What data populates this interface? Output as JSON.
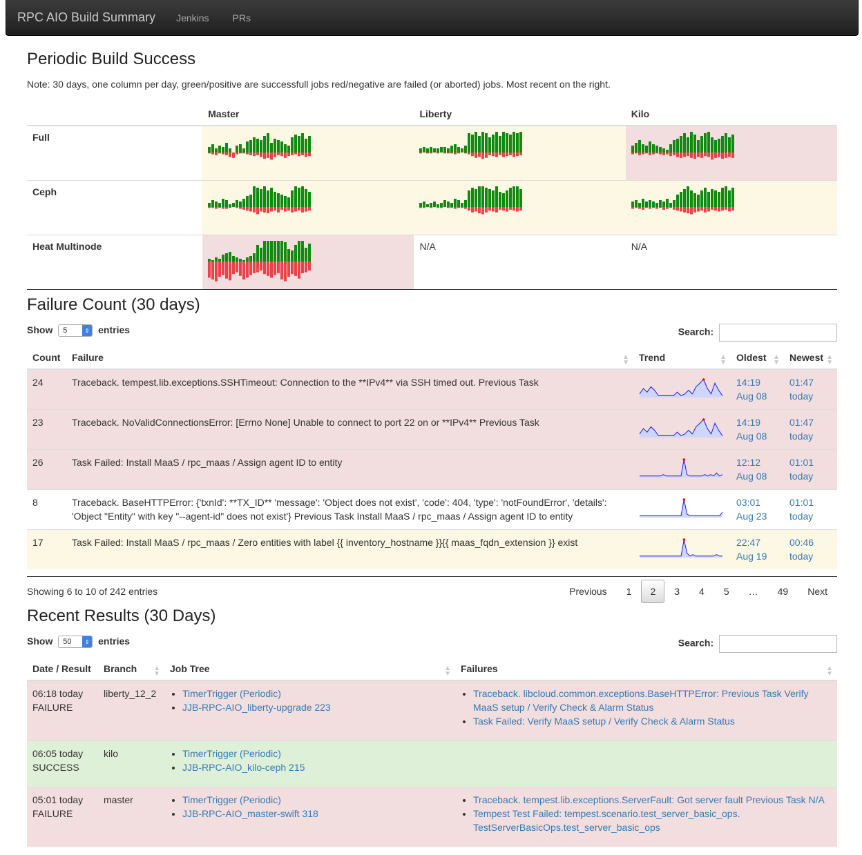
{
  "nav": {
    "brand": "RPC AIO Build Summary",
    "links": [
      "Jenkins",
      "PRs"
    ]
  },
  "periodic": {
    "title": "Periodic Build Success",
    "note": "Note: 30 days, one column per day, green/positive are successfull jobs red/negative are failed (or aborted) jobs. Most recent on the right.",
    "columns": [
      "Master",
      "Liberty",
      "Kilo"
    ],
    "rows": [
      {
        "label": "Full",
        "cells": [
          {
            "status": "warning",
            "ok": [
              4,
              6,
              3,
              5,
              4,
              7,
              3,
              0,
              5,
              6,
              3,
              8,
              9,
              11,
              10,
              9,
              12,
              14,
              7,
              10,
              9,
              8,
              6,
              5,
              11,
              13,
              12,
              14,
              10,
              12
            ],
            "fail": [
              1,
              2,
              3,
              1,
              2,
              3,
              5,
              6,
              2,
              1,
              1,
              2,
              3,
              4,
              3,
              5,
              7,
              6,
              8,
              5,
              3,
              4,
              6,
              4,
              3,
              2,
              4,
              3,
              5,
              4
            ]
          },
          {
            "status": "warning",
            "ok": [
              3,
              4,
              3,
              4,
              3,
              3,
              4,
              4,
              3,
              5,
              6,
              4,
              3,
              5,
              14,
              13,
              15,
              12,
              16,
              14,
              11,
              13,
              15,
              12,
              16,
              14,
              13,
              15,
              14,
              16
            ],
            "fail": [
              1,
              0,
              1,
              1,
              0,
              1,
              0,
              1,
              1,
              1,
              2,
              1,
              0,
              1,
              2,
              4,
              6,
              5,
              7,
              6,
              3,
              4,
              5,
              3,
              5,
              4,
              3,
              5,
              4,
              3
            ]
          },
          {
            "status": "danger",
            "ok": [
              5,
              7,
              9,
              6,
              5,
              8,
              6,
              5,
              4,
              3,
              2,
              6,
              9,
              10,
              12,
              14,
              11,
              15,
              13,
              9,
              12,
              14,
              16,
              11,
              9,
              10,
              12,
              14,
              11,
              13
            ],
            "fail": [
              2,
              1,
              3,
              2,
              1,
              3,
              2,
              1,
              2,
              3,
              2,
              4,
              3,
              5,
              6,
              5,
              4,
              6,
              7,
              5,
              6,
              4,
              5,
              8,
              6,
              5,
              7,
              6,
              5,
              6
            ]
          }
        ]
      },
      {
        "label": "Ceph",
        "cells": [
          {
            "status": "warning",
            "ok": [
              3,
              5,
              4,
              3,
              6,
              5,
              2,
              3,
              5,
              4,
              6,
              8,
              9,
              15,
              14,
              13,
              15,
              12,
              14,
              11,
              10,
              9,
              8,
              7,
              12,
              16,
              14,
              15,
              13,
              11
            ],
            "fail": [
              1,
              1,
              2,
              1,
              2,
              2,
              1,
              0,
              1,
              2,
              3,
              4,
              5,
              6,
              8,
              5,
              6,
              7,
              5,
              4,
              6,
              3,
              5,
              4,
              6,
              5,
              4,
              6,
              5,
              4
            ]
          },
          {
            "status": "warning",
            "ok": [
              3,
              4,
              2,
              3,
              4,
              2,
              3,
              5,
              4,
              3,
              6,
              5,
              3,
              5,
              12,
              14,
              13,
              15,
              16,
              14,
              13,
              12,
              15,
              11,
              10,
              12,
              14,
              16,
              15,
              13
            ],
            "fail": [
              1,
              1,
              0,
              1,
              0,
              1,
              1,
              0,
              1,
              1,
              2,
              1,
              1,
              2,
              4,
              6,
              5,
              7,
              8,
              6,
              4,
              5,
              6,
              3,
              4,
              5,
              3,
              4,
              5,
              4
            ]
          },
          {
            "status": "warning",
            "ok": [
              4,
              5,
              3,
              6,
              4,
              5,
              4,
              3,
              5,
              4,
              6,
              3,
              5,
              9,
              11,
              13,
              15,
              12,
              10,
              9,
              12,
              14,
              11,
              13,
              12,
              11,
              14,
              16,
              12,
              14
            ],
            "fail": [
              2,
              1,
              2,
              3,
              1,
              2,
              1,
              2,
              1,
              3,
              2,
              1,
              3,
              4,
              5,
              6,
              7,
              8,
              6,
              5,
              4,
              6,
              5,
              3,
              4,
              5,
              4,
              3,
              5,
              4
            ]
          }
        ]
      },
      {
        "label": "Heat Multinode",
        "cells": [
          {
            "status": "danger",
            "ok": [
              2,
              1,
              3,
              2,
              5,
              6,
              7,
              4,
              3,
              2,
              1,
              3,
              4,
              6,
              12,
              10,
              18,
              22,
              15,
              20,
              25,
              16,
              14,
              9,
              8,
              12,
              18,
              15,
              10,
              13
            ],
            "fail": [
              18,
              20,
              22,
              17,
              15,
              19,
              21,
              14,
              12,
              16,
              20,
              18,
              15,
              13,
              12,
              10,
              14,
              16,
              18,
              15,
              13,
              20,
              22,
              17,
              14,
              16,
              19,
              13,
              12,
              10
            ]
          },
          {
            "status": "none",
            "text": "N/A"
          },
          {
            "status": "none",
            "text": "N/A"
          }
        ]
      }
    ]
  },
  "failure_count": {
    "title": "Failure Count (30 days)",
    "show_label": "Show",
    "entries_label": "entries",
    "page_length": "5",
    "search_label": "Search:",
    "columns": [
      "Count",
      "Failure",
      "Trend",
      "Oldest",
      "Newest"
    ],
    "rows": [
      {
        "status": "danger",
        "count": "24",
        "failure": "Traceback. tempest.lib.exceptions.SSHTimeout: Connection to the **IPv4** via SSH timed out. Previous Task",
        "trend": [
          2,
          5,
          3,
          6,
          4,
          1,
          1,
          1,
          1,
          1,
          3,
          1,
          2,
          4,
          2,
          6,
          8,
          10,
          5,
          2,
          8,
          4,
          1
        ],
        "oldest_time": "14:19",
        "oldest_date": "Aug 08",
        "newest_time": "01:47",
        "newest_date": "today"
      },
      {
        "status": "danger",
        "count": "23",
        "failure": "Traceback. NoValidConnectionsError: [Errno None] Unable to connect to port 22 on or **IPv4** Previous Task",
        "trend": [
          2,
          5,
          3,
          6,
          4,
          1,
          1,
          1,
          1,
          1,
          3,
          1,
          2,
          4,
          2,
          6,
          8,
          10,
          5,
          2,
          8,
          4,
          1
        ],
        "oldest_time": "14:19",
        "oldest_date": "Aug 08",
        "newest_time": "01:47",
        "newest_date": "today"
      },
      {
        "status": "danger",
        "count": "26",
        "failure": "Task Failed: Install MaaS / rpc_maas / Assign agent ID to entity",
        "trend": [
          1,
          1,
          1,
          1,
          1,
          1,
          1,
          1,
          2,
          1,
          1,
          1,
          1,
          1,
          1,
          12,
          2,
          1,
          1,
          1,
          1,
          1,
          2,
          1,
          2,
          1,
          3,
          1,
          2
        ],
        "oldest_time": "12:12",
        "oldest_date": "Aug 08",
        "newest_time": "01:01",
        "newest_date": "today"
      },
      {
        "status": "none",
        "count": "8",
        "failure": "Traceback. BaseHTTPError: {'txnId': **TX_ID** 'message': 'Object does not exist', 'code': 404, 'type': 'notFoundError', 'details': 'Object \"Entity\" with key \"--agent-id\" does not exist'} Previous Task Install MaaS / rpc_maas / Assign agent ID to entity",
        "trend": [
          1,
          1,
          1,
          1,
          1,
          1,
          1,
          1,
          1,
          1,
          1,
          1,
          1,
          1,
          1,
          10,
          2,
          1,
          1,
          1,
          1,
          1,
          1,
          1,
          1,
          1,
          1,
          1,
          3
        ],
        "oldest_time": "03:01",
        "oldest_date": "Aug 23",
        "newest_time": "01:01",
        "newest_date": "today"
      },
      {
        "status": "warning",
        "count": "17",
        "failure": "Task Failed: Install MaaS / rpc_maas / Zero entities with label {{ inventory_hostname }}{{ maas_fqdn_extension }} exist",
        "trend": [
          1,
          1,
          1,
          1,
          1,
          1,
          1,
          1,
          1,
          1,
          1,
          1,
          1,
          1,
          1,
          12,
          3,
          1,
          2,
          1,
          1,
          1,
          1,
          1,
          1,
          1,
          2,
          1,
          1
        ],
        "oldest_time": "22:47",
        "oldest_date": "Aug 19",
        "newest_time": "00:46",
        "newest_date": "today"
      }
    ],
    "info": "Showing 6 to 10 of 242 entries",
    "pagination": [
      "Previous",
      "1",
      "2",
      "3",
      "4",
      "5",
      "…",
      "49",
      "Next"
    ],
    "active_page": "2"
  },
  "recent": {
    "title": "Recent Results (30 Days)",
    "show_label": "Show",
    "entries_label": "entries",
    "page_length": "50",
    "search_label": "Search:",
    "columns": [
      "Date / Result",
      "Branch",
      "Job Tree",
      "Failures"
    ],
    "rows": [
      {
        "status": "danger",
        "date": "06:18 today",
        "result": "FAILURE",
        "branch": "liberty_12_2",
        "jobs": [
          "TimerTrigger (Periodic)",
          "JJB-RPC-AIO_liberty-upgrade 223"
        ],
        "failures": [
          "Traceback. libcloud.common.exceptions.BaseHTTPError: Previous Task Verify MaaS setup / Verify Check & Alarm Status",
          "Task Failed: Verify MaaS setup / Verify Check & Alarm Status"
        ]
      },
      {
        "status": "success",
        "date": "06:05 today",
        "result": "SUCCESS",
        "branch": "kilo",
        "jobs": [
          "TimerTrigger (Periodic)",
          "JJB-RPC-AIO_kilo-ceph 215"
        ],
        "failures": []
      },
      {
        "status": "danger",
        "date": "05:01 today",
        "result": "FAILURE",
        "branch": "master",
        "jobs": [
          "TimerTrigger (Periodic)",
          "JJB-RPC-AIO_master-swift 318"
        ],
        "failures": [
          "Traceback. tempest.lib.exceptions.ServerFault: Got server fault Previous Task N/A",
          "Tempest Test Failed: tempest.scenario.test_server_basic_ops. TestServerBasicOps.test_server_basic_ops"
        ]
      }
    ]
  },
  "colors": {
    "ok": "#118a11",
    "fail": "#e8424a",
    "warning_bg": "#fcf8e3",
    "danger_bg": "#f2dede",
    "success_bg": "#dff0d8",
    "trend_line": "#1a1aff",
    "trend_peak": "#ff0000"
  }
}
